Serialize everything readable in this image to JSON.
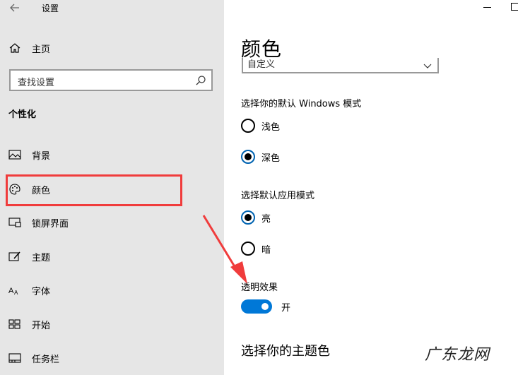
{
  "app": {
    "title": "设置"
  },
  "sidebar": {
    "home_label": "主页",
    "search_placeholder": "查找设置",
    "section_title": "个性化",
    "items": [
      {
        "label": "背景",
        "icon": "picture-icon"
      },
      {
        "label": "颜色",
        "icon": "palette-icon",
        "selected": true
      },
      {
        "label": "锁屏界面",
        "icon": "lock-screen-icon"
      },
      {
        "label": "主题",
        "icon": "theme-brush-icon"
      },
      {
        "label": "字体",
        "icon": "font-icon"
      },
      {
        "label": "开始",
        "icon": "start-tiles-icon"
      },
      {
        "label": "任务栏",
        "icon": "taskbar-icon"
      }
    ]
  },
  "main": {
    "page_title": "颜色",
    "color_dropdown_value": "自定义",
    "windows_mode": {
      "label": "选择你的默认 Windows 模式",
      "options": [
        {
          "label": "浅色",
          "selected": false
        },
        {
          "label": "深色",
          "selected": true
        }
      ]
    },
    "app_mode": {
      "label": "选择默认应用模式",
      "options": [
        {
          "label": "亮",
          "selected": true
        },
        {
          "label": "暗",
          "selected": false
        }
      ]
    },
    "transparency": {
      "label": "透明效果",
      "state_label": "开",
      "on": true
    },
    "accent_heading": "选择你的主题色"
  },
  "annotation": {
    "highlight_color": "#f03c3c",
    "watermark": "广东龙网"
  },
  "colors": {
    "sidebar_bg": "#e6e6e6",
    "accent": "#0078d7"
  }
}
